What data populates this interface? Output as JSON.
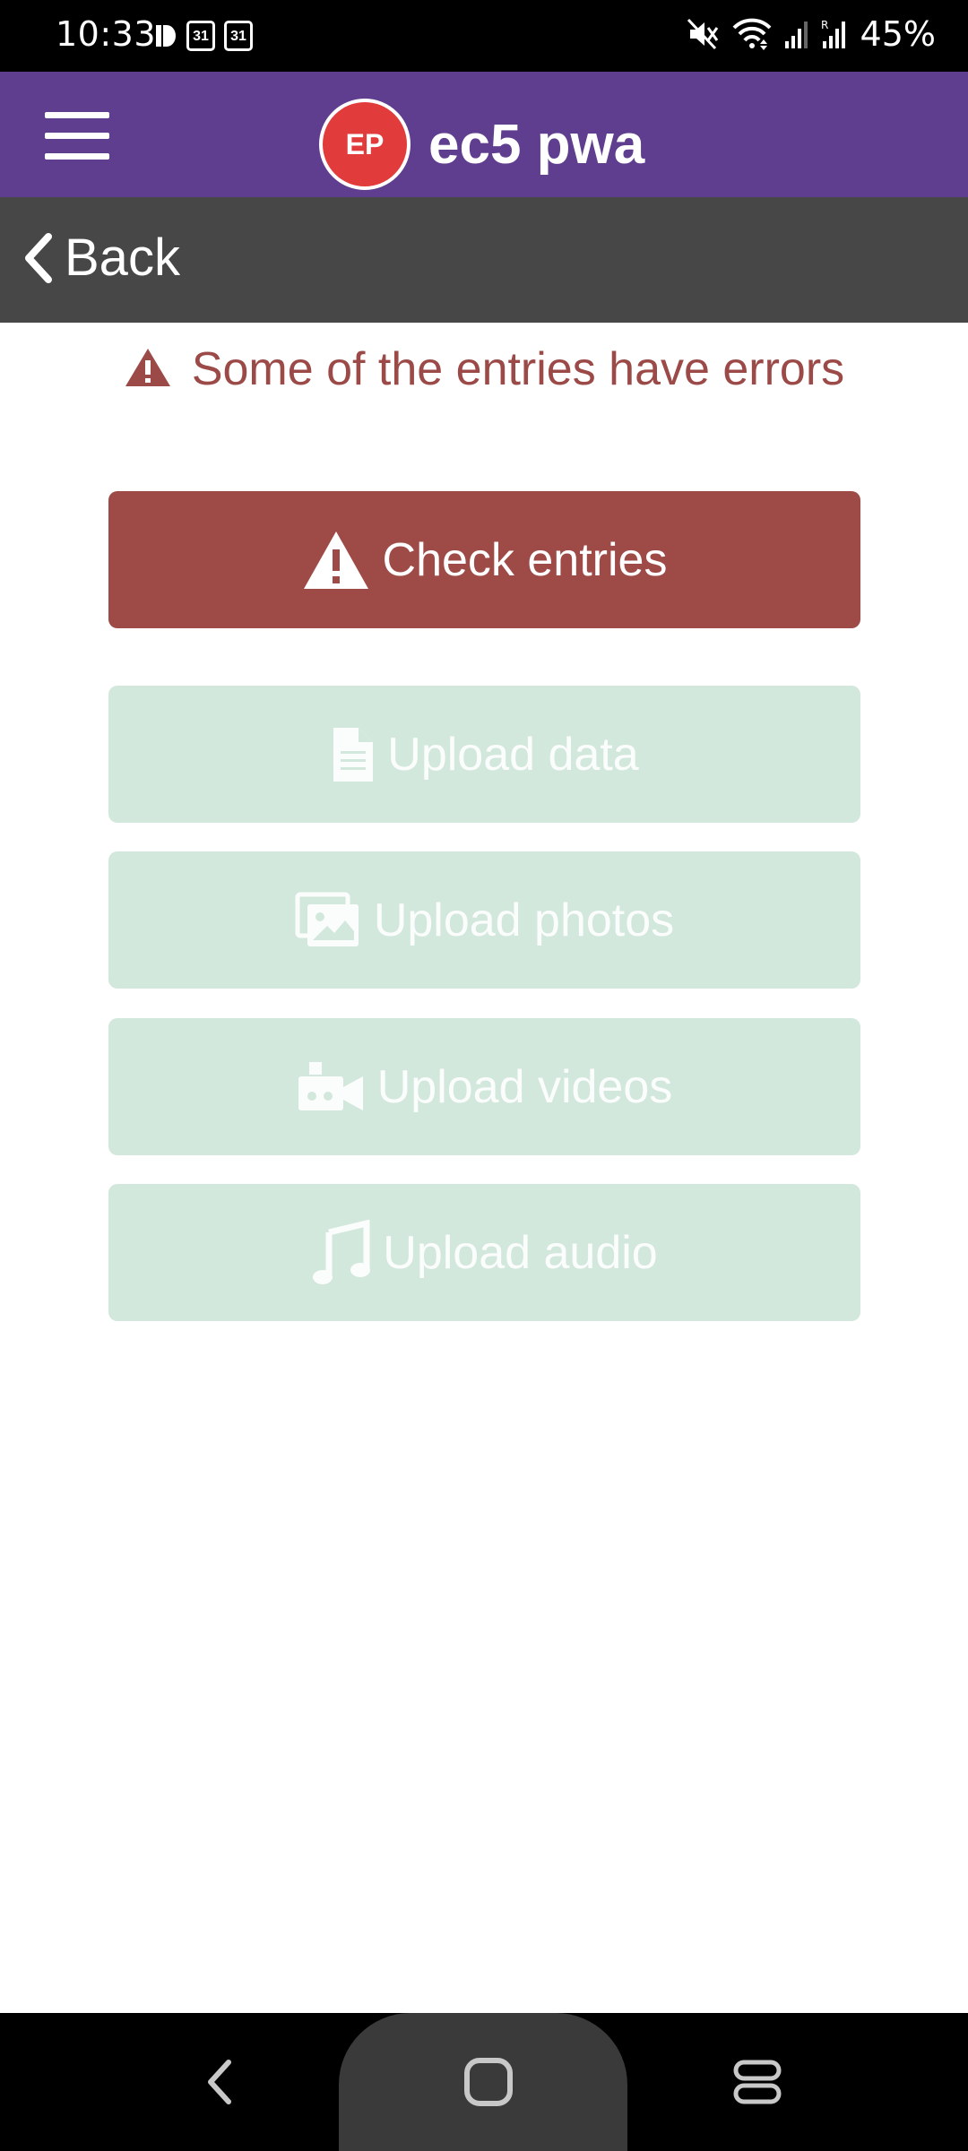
{
  "status_bar": {
    "time": "10:33",
    "calendar_day_1": "31",
    "calendar_day_2": "31",
    "battery": "45%"
  },
  "header": {
    "menu_icon": "hamburger-menu-icon",
    "logo_text": "EP",
    "title": "ec5 pwa",
    "brand_color": "#5f3d8f"
  },
  "back_bar": {
    "label": "Back"
  },
  "alert": {
    "message": "Some of the entries have errors",
    "color": "#9b4a48"
  },
  "buttons": {
    "check_entries": "Check entries",
    "upload_data": "Upload data",
    "upload_photos": "Upload photos",
    "upload_videos": "Upload videos",
    "upload_audio": "Upload audio"
  },
  "colors": {
    "error_button": "#9e4b47",
    "disabled_upload": "#d3e8dd"
  }
}
